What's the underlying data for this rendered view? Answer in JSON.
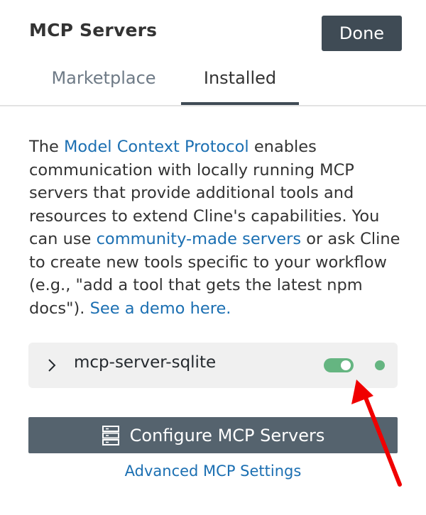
{
  "header": {
    "title": "MCP Servers",
    "done_label": "Done"
  },
  "tabs": [
    {
      "label": "Marketplace",
      "active": false
    },
    {
      "label": "Installed",
      "active": true
    }
  ],
  "description": {
    "text_1": "The ",
    "link_protocol": "Model Context Protocol",
    "text_2": " enables communication with locally running MCP servers that provide additional tools and resources to extend Cline's capabilities. You can use ",
    "link_community": "community-made servers",
    "text_3": " or ask Cline to create new tools specific to your workflow (e.g., \"add a tool that gets the latest npm docs\"). ",
    "link_demo": "See a demo here."
  },
  "servers": [
    {
      "name": "mcp-server-sqlite",
      "enabled": true,
      "status_color": "#65b581"
    }
  ],
  "footer": {
    "configure_label": "Configure MCP Servers",
    "advanced_label": "Advanced MCP Settings"
  },
  "colors": {
    "accent_link": "#1b6fb2",
    "toggle_on": "#65b581",
    "button_dark": "#3f4b55",
    "button_configure": "#55636e",
    "annotation_arrow": "#f00000"
  },
  "icons": {
    "chevron": "chevron-right-icon",
    "configure": "server-stack-icon"
  }
}
